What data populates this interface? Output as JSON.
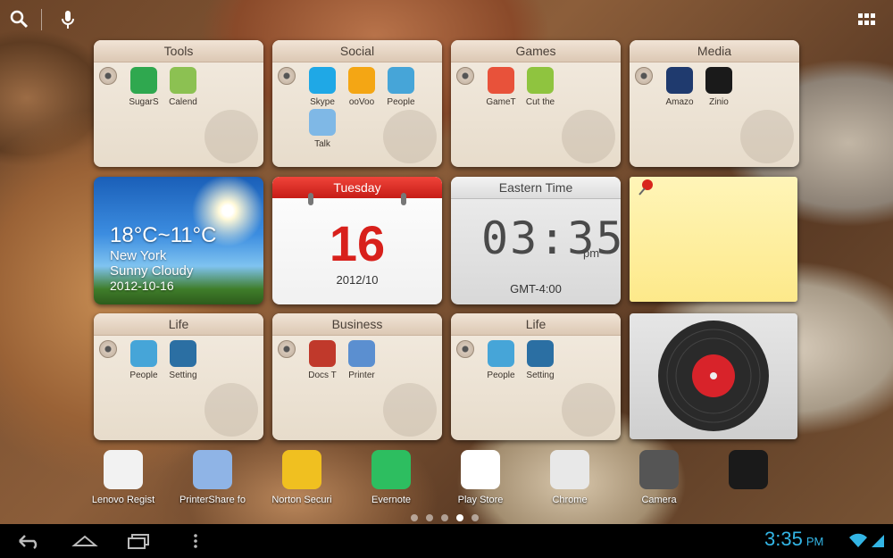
{
  "folders": [
    {
      "title": "Tools",
      "apps": [
        {
          "label": "SugarS",
          "icon": "hummingbird-icon",
          "color": "#2fa84f"
        },
        {
          "label": "Calend",
          "icon": "calendar-icon",
          "color": "#8cc152"
        }
      ]
    },
    {
      "title": "Social",
      "apps": [
        {
          "label": "Skype",
          "icon": "skype-icon",
          "color": "#1fa8e6"
        },
        {
          "label": "ooVoo",
          "icon": "oovoo-icon",
          "color": "#f4a614"
        },
        {
          "label": "People",
          "icon": "people-icon",
          "color": "#46a5d8"
        },
        {
          "label": "Talk",
          "icon": "talk-icon",
          "color": "#7fb8e6"
        }
      ]
    },
    {
      "title": "Games",
      "apps": [
        {
          "label": "GameT",
          "icon": "game-cube-icon",
          "color": "#e8523a"
        },
        {
          "label": "Cut the",
          "icon": "cut-the-rope-icon",
          "color": "#8fc43f"
        }
      ]
    },
    {
      "title": "Media",
      "apps": [
        {
          "label": "Amazo",
          "icon": "kindle-icon",
          "color": "#1f3a6e"
        },
        {
          "label": "Zinio",
          "icon": "zinio-icon",
          "color": "#1a1a1a"
        }
      ]
    },
    {
      "title": "Life",
      "apps": [
        {
          "label": "People",
          "icon": "people-icon",
          "color": "#46a5d8"
        },
        {
          "label": "Setting",
          "icon": "settings-icon",
          "color": "#2b6fa3"
        }
      ]
    },
    {
      "title": "Business",
      "apps": [
        {
          "label": "Docs T",
          "icon": "docs-icon",
          "color": "#c0392b"
        },
        {
          "label": "Printer",
          "icon": "printer-icon",
          "color": "#5b8fd0"
        }
      ]
    },
    {
      "title": "Life",
      "apps": [
        {
          "label": "People",
          "icon": "people-icon",
          "color": "#46a5d8"
        },
        {
          "label": "Setting",
          "icon": "settings-icon",
          "color": "#2b6fa3"
        }
      ]
    }
  ],
  "weather": {
    "temp": "18°C~11°C",
    "city": "New York",
    "condition": "Sunny Cloudy",
    "date": "2012-10-16"
  },
  "calendar": {
    "weekday": "Tuesday",
    "day": "16",
    "month": "2012/10"
  },
  "clock": {
    "title": "Eastern Time",
    "time": "03:35",
    "ampm": "pm",
    "zone": "GMT-4:00"
  },
  "dock": [
    {
      "label": "Lenovo Regist",
      "icon": "registration-form-icon"
    },
    {
      "label": "PrinterShare fo",
      "icon": "printershare-icon"
    },
    {
      "label": "Norton Securi",
      "icon": "norton-icon"
    },
    {
      "label": "Evernote",
      "icon": "evernote-icon"
    },
    {
      "label": "Play Store",
      "icon": "play-store-icon"
    },
    {
      "label": "Chrome",
      "icon": "chrome-icon"
    },
    {
      "label": "Camera",
      "icon": "camera-icon"
    },
    {
      "label": "",
      "icon": "app-icon"
    }
  ],
  "page_indicator": {
    "count": 5,
    "active": 1
  },
  "status": {
    "time": "3:35",
    "ampm": "PM"
  }
}
